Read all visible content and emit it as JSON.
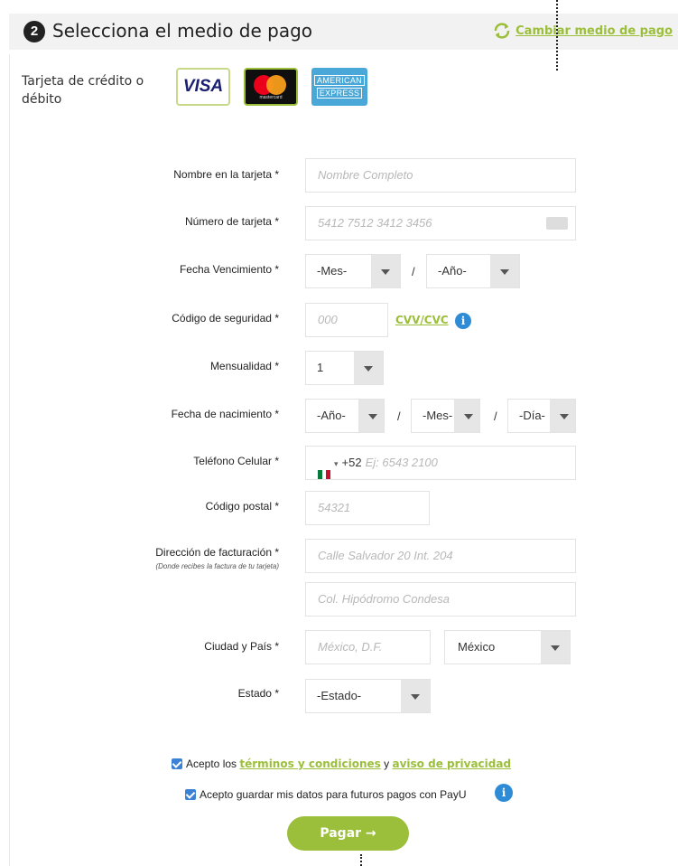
{
  "header": {
    "step_number": "2",
    "title": "Selecciona el medio de pago",
    "change_link": "Cambiar medio de pago"
  },
  "card_section": {
    "label": "Tarjeta de crédito o débito",
    "visa": "VISA",
    "mastercard": "mastercard",
    "amex_line1": "AMERICAN",
    "amex_line2": "EXPRESS"
  },
  "form": {
    "name": {
      "label": "Nombre en la tarjeta *",
      "placeholder": "Nombre Completo"
    },
    "card_number": {
      "label": "Número de tarjeta *",
      "placeholder": "5412 7512 3412 3456"
    },
    "expiry": {
      "label": "Fecha Vencimiento *",
      "month": "-Mes-",
      "year": "-Año-",
      "separator": "/"
    },
    "cvv": {
      "label": "Código de seguridad *",
      "placeholder": "000",
      "link": "CVV/CVC"
    },
    "installments": {
      "label": "Mensualidad *",
      "value": "1"
    },
    "birthdate": {
      "label": "Fecha de nacimiento *",
      "year": "-Año-",
      "month": "-Mes-",
      "day": "-Día-",
      "separator": "/"
    },
    "phone": {
      "label": "Teléfono Celular *",
      "prefix": "+52",
      "placeholder": "Ej: 6543 2100"
    },
    "postal": {
      "label": "Código postal *",
      "placeholder": "54321"
    },
    "billing": {
      "label": "Dirección de facturación *",
      "sublabel": "(Donde recibes la factura de tu tarjeta)",
      "line1_placeholder": "Calle Salvador 20 Int. 204",
      "line2_placeholder": "Col. Hipódromo Condesa"
    },
    "city_country": {
      "label": "Ciudad y País *",
      "city_placeholder": "México, D.F.",
      "country": "México"
    },
    "state": {
      "label": "Estado *",
      "value": "-Estado-"
    }
  },
  "consent": {
    "terms_prefix": "Acepto los",
    "terms_link": "términos y condiciones",
    "terms_and": "y",
    "privacy_link": "aviso de privacidad",
    "save_data": "Acepto guardar mis datos para futuros pagos con PayU"
  },
  "pay_button": "Pagar →",
  "colors": {
    "accent_green": "#9bbf3a",
    "info_blue": "#2e8bd6"
  }
}
